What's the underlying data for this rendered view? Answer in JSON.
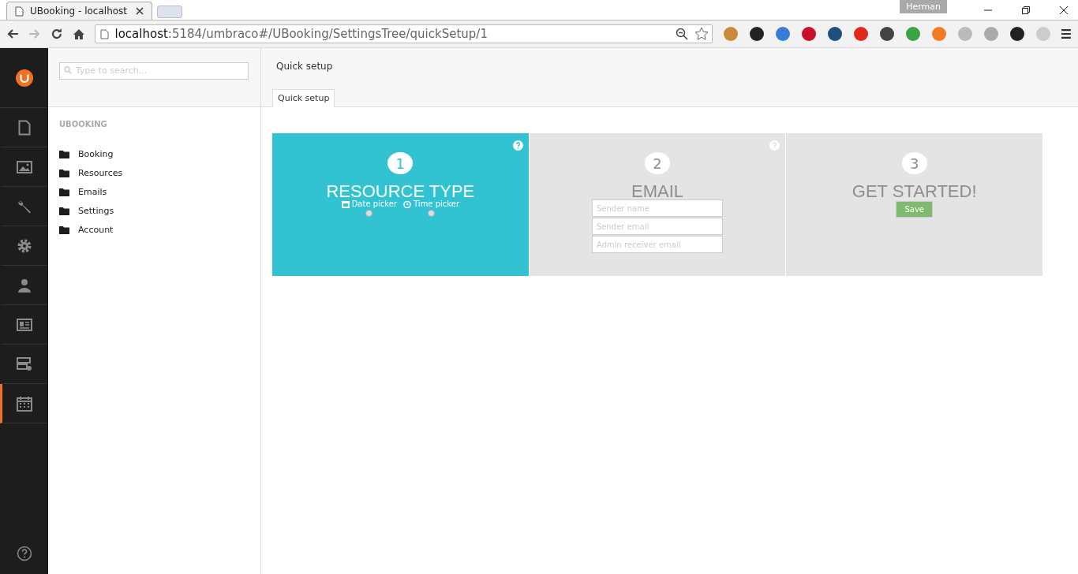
{
  "browser": {
    "tab_title": "UBooking - localhost",
    "user": "Herman",
    "url_host": "localhost",
    "url_rest": ":5184/umbraco#/UBooking/SettingsTree/quickSetup/1"
  },
  "sections": [
    {
      "kind": "content",
      "selected": false
    },
    {
      "kind": "media",
      "selected": false
    },
    {
      "kind": "settings",
      "selected": false
    },
    {
      "kind": "developer",
      "selected": false
    },
    {
      "kind": "users",
      "selected": false
    },
    {
      "kind": "members",
      "selected": false
    },
    {
      "kind": "forms",
      "selected": false
    },
    {
      "kind": "calendar",
      "selected": true
    }
  ],
  "tree": {
    "search_placeholder": "Type to search...",
    "title": "UBOOKING",
    "items": [
      "Booking",
      "Resources",
      "Emails",
      "Settings",
      "Account"
    ]
  },
  "editor": {
    "title": "Quick setup",
    "tabs": [
      {
        "label": "Quick setup",
        "selected": true
      }
    ]
  },
  "steps": [
    {
      "number": "1",
      "title": "RESOURCE TYPE",
      "selected": true,
      "help": true,
      "kind": "options",
      "options": [
        {
          "label": "Date picker",
          "selected": false
        },
        {
          "label": "Time picker",
          "selected": false
        }
      ]
    },
    {
      "number": "2",
      "title": "EMAIL",
      "selected": false,
      "help": true,
      "kind": "fields",
      "fields": [
        {
          "placeholder": "Sender name"
        },
        {
          "placeholder": "Sender email"
        },
        {
          "placeholder": "Admin receiver email"
        }
      ]
    },
    {
      "number": "3",
      "title": "GET STARTED!",
      "selected": false,
      "help": false,
      "kind": "action",
      "button": "Save"
    }
  ]
}
